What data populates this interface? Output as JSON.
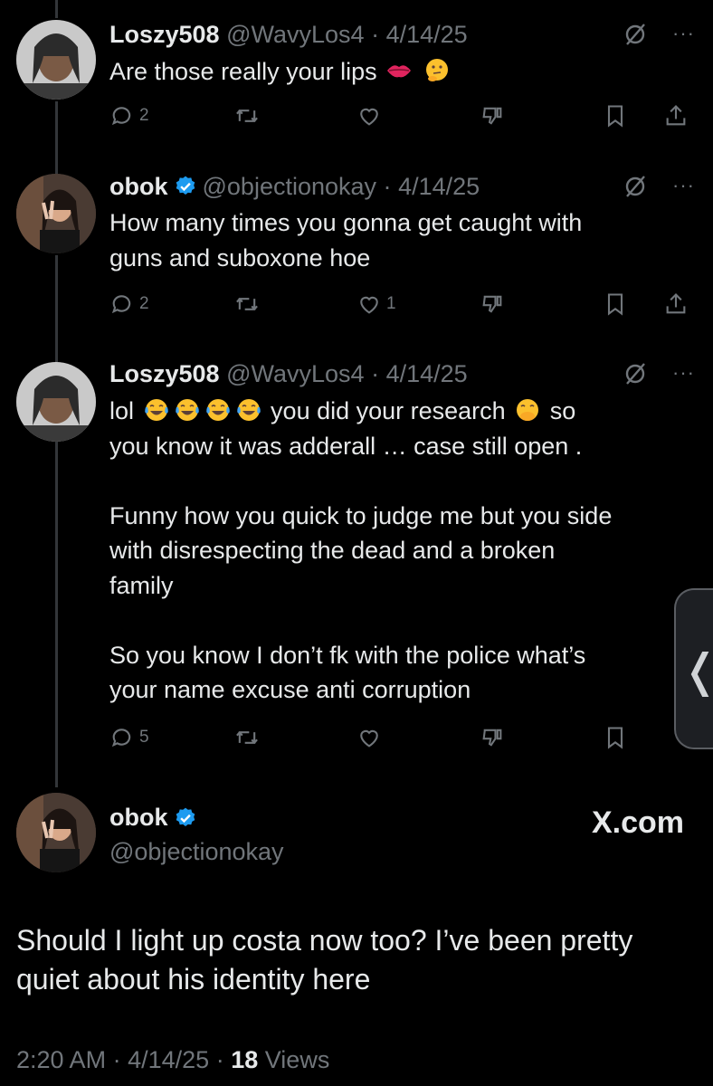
{
  "tweets": [
    {
      "name": "Loszy508",
      "handle": "@WavyLos4",
      "dot": "·",
      "date": "4/14/25",
      "lines": [
        "Are those really your lips"
      ],
      "emojis": [
        "lips-emoji",
        "thinking-face-emoji"
      ],
      "actions": {
        "replies": "2",
        "retweets": "",
        "likes": "",
        "dislikes": ""
      }
    },
    {
      "name": "obok",
      "handle": "@objectionokay",
      "dot": "·",
      "date": "4/14/25",
      "lines": [
        "How many times you gonna get caught with",
        "guns and suboxone hoe"
      ],
      "actions": {
        "replies": "2",
        "retweets": "",
        "likes": "1",
        "dislikes": ""
      }
    },
    {
      "name": "Loszy508",
      "handle": "@WavyLos4",
      "dot": "·",
      "date": "4/14/25",
      "line1_a": "lol",
      "line1_b": "you did your research",
      "line1_c": "so",
      "lines": [
        "you know it was adderall … case still open .",
        "",
        "Funny how you quick to judge me but you side",
        "with disrespecting the dead and a broken",
        "family",
        "",
        "So you know I don’t fk with the police what’s",
        "your name excuse anti corruption"
      ],
      "emojis": [
        "tears-of-joy-emoji",
        "face-with-hand-over-mouth-emoji"
      ],
      "actions": {
        "replies": "5",
        "retweets": "",
        "likes": "",
        "dislikes": ""
      }
    }
  ],
  "main_tweet": {
    "name": "obok",
    "handle": "@objectionokay",
    "brand": "X.com",
    "text_lines": [
      "Should I light up costa now too? I’ve been pretty",
      "quiet about his identity here"
    ],
    "time": "2:20 AM",
    "dot": "·",
    "date": "4/14/25",
    "views_count": "18",
    "views_label": "Views"
  },
  "more_glyph": "···",
  "side_tab_glyph": "❬",
  "colors": {
    "background": "#000000",
    "text": "#e7e9ea",
    "muted": "#71767b",
    "verified": "#1d9bf0"
  },
  "icons": [
    "reply-icon",
    "retweet-icon",
    "like-icon",
    "dislike-icon",
    "bookmark-icon",
    "share-icon",
    "grok-icon",
    "verified-badge-icon"
  ]
}
